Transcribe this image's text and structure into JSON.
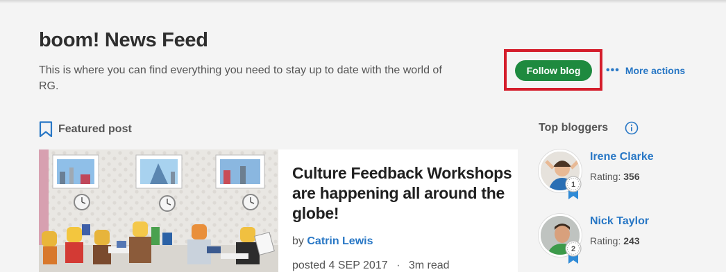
{
  "header": {
    "title": "boom! News Feed",
    "description": "This is where you can find everything you need to stay up to date with the world of RG.",
    "follow_label": "Follow blog",
    "more_actions_label": "More actions",
    "more_actions_dots": "•••"
  },
  "featured": {
    "section_label": "Featured post",
    "post_title": "Culture Feedback Workshops are happening all around the globe!",
    "by_label": "by",
    "author": "Catrin Lewis",
    "posted_label": "posted",
    "date": "4 SEP 2017",
    "separator": "·",
    "read_time": "3m read"
  },
  "bloggers": {
    "title": "Top bloggers",
    "rating_label": "Rating:",
    "items": [
      {
        "rank": "1",
        "name": "Irene Clarke",
        "rating": "356"
      },
      {
        "rank": "2",
        "name": "Nick Taylor",
        "rating": "243"
      }
    ]
  },
  "colors": {
    "accent_blue": "#2877c5",
    "follow_green": "#1e8a3f",
    "highlight_red": "#d41d2b"
  }
}
